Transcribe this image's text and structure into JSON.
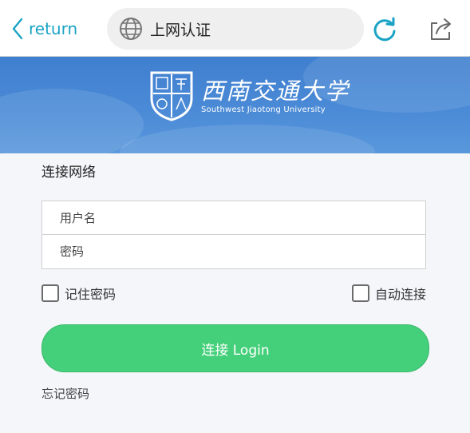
{
  "browser": {
    "back_label": "return",
    "address_text": "上网认证"
  },
  "banner": {
    "school_name_cn": "西南交通大学",
    "school_name_en": "Southwest Jiaotong University"
  },
  "form": {
    "title": "连接网络",
    "username_placeholder": "用户名",
    "password_placeholder": "密码",
    "remember_label": "记住密码",
    "auto_connect_label": "自动连接",
    "login_label": "连接 Login",
    "forgot_label": "忘记密码"
  },
  "colors": {
    "accent": "#1aa3c4",
    "banner": "#4a8ad6",
    "button": "#44d07a"
  },
  "icons": [
    "back-chevron-icon",
    "globe-icon",
    "reload-icon",
    "share-icon",
    "university-crest-icon"
  ]
}
